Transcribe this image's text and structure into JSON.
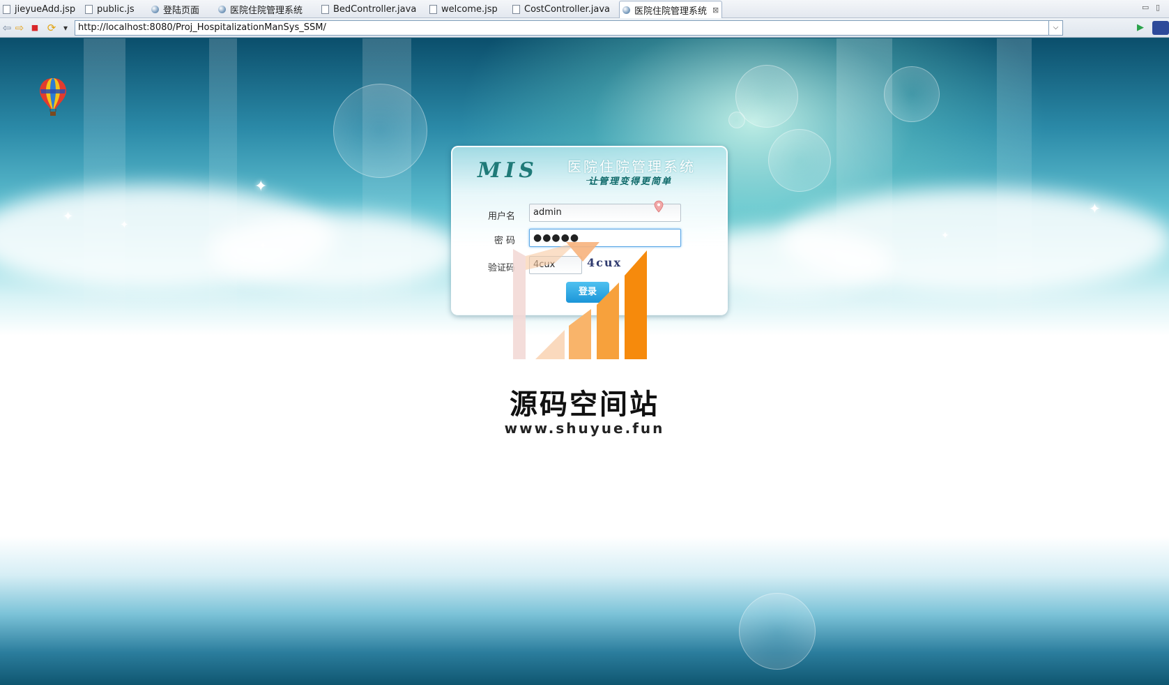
{
  "tabs": [
    {
      "label": "jieyueAdd.jsp",
      "icon": "file-icon"
    },
    {
      "label": "public.js",
      "icon": "js-file-icon"
    },
    {
      "label": "登陆页面",
      "icon": "globe-icon"
    },
    {
      "label": "医院住院管理系统",
      "icon": "globe-icon"
    },
    {
      "label": "BedController.java",
      "icon": "java-file-icon"
    },
    {
      "label": "welcome.jsp",
      "icon": "file-icon"
    },
    {
      "label": "CostController.java",
      "icon": "java-file-icon"
    },
    {
      "label": "医院住院管理系统",
      "icon": "globe-icon",
      "active": true
    }
  ],
  "tab_close": "⊠",
  "window_controls": {
    "minimize": "▭",
    "maximize": "▯"
  },
  "toolbar": {
    "back": "⇦",
    "forward": "⇨",
    "stop": "■",
    "refresh": "⟳",
    "menu": "▾",
    "address": "http://localhost:8080/Proj_HospitalizationManSys_SSM/",
    "address_dropdown": "⌵",
    "go": "▶"
  },
  "login": {
    "logo": "MIS",
    "system_title": "医院住院管理系统",
    "slogan": "让管理变得更简单",
    "username_label": "用户名",
    "username_value": "admin",
    "password_label": "密 码",
    "password_value": "●●●●●",
    "captcha_label": "验证码",
    "captcha_value": "4cux",
    "captcha_image_text": "4cux",
    "login_button": "登录"
  },
  "watermark": {
    "name": "源码空间站",
    "url": "www.shuyue.fun"
  },
  "colors": {
    "accent": "#1b95d8",
    "teal": "#1f7a78",
    "orange": "#f7931e"
  }
}
